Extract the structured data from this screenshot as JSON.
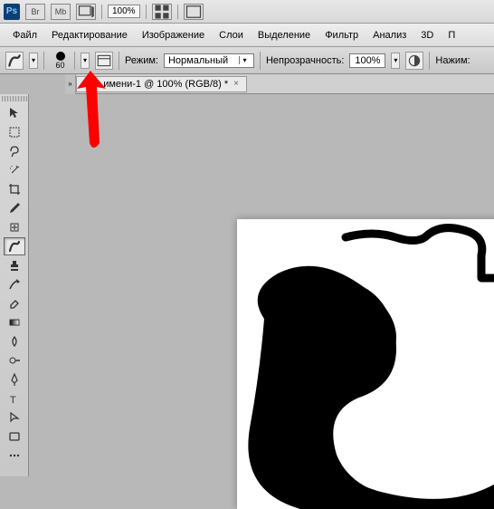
{
  "titlebar": {
    "br_label": "Br",
    "mb_label": "Mb",
    "zoom": "100%"
  },
  "menu": {
    "file": "Файл",
    "edit": "Редактирование",
    "image": "Изображение",
    "layers": "Слои",
    "select": "Выделение",
    "filter": "Фильтр",
    "analyze": "Анализ",
    "threed": "3D",
    "view": "П"
  },
  "options": {
    "brush_size": "60",
    "mode_label": "Режим:",
    "mode_value": "Нормальный",
    "opacity_label": "Непрозрачность:",
    "opacity_value": "100%",
    "flow_label": "Нажим:"
  },
  "tab": {
    "title": "Без имени-1 @ 100% (RGB/8) *"
  },
  "tools": {
    "move": "move-tool",
    "marquee": "marquee-tool",
    "lasso": "lasso-tool",
    "wand": "wand-tool",
    "crop": "crop-tool",
    "eyedropper": "eyedropper-tool",
    "healing": "healing-tool",
    "brush": "brush-tool",
    "stamp": "stamp-tool",
    "history": "history-brush-tool",
    "eraser": "eraser-tool",
    "gradient": "gradient-tool",
    "blur": "blur-tool",
    "dodge": "dodge-tool",
    "pen": "pen-tool",
    "type": "type-tool",
    "path": "path-select-tool",
    "shape": "shape-tool"
  }
}
